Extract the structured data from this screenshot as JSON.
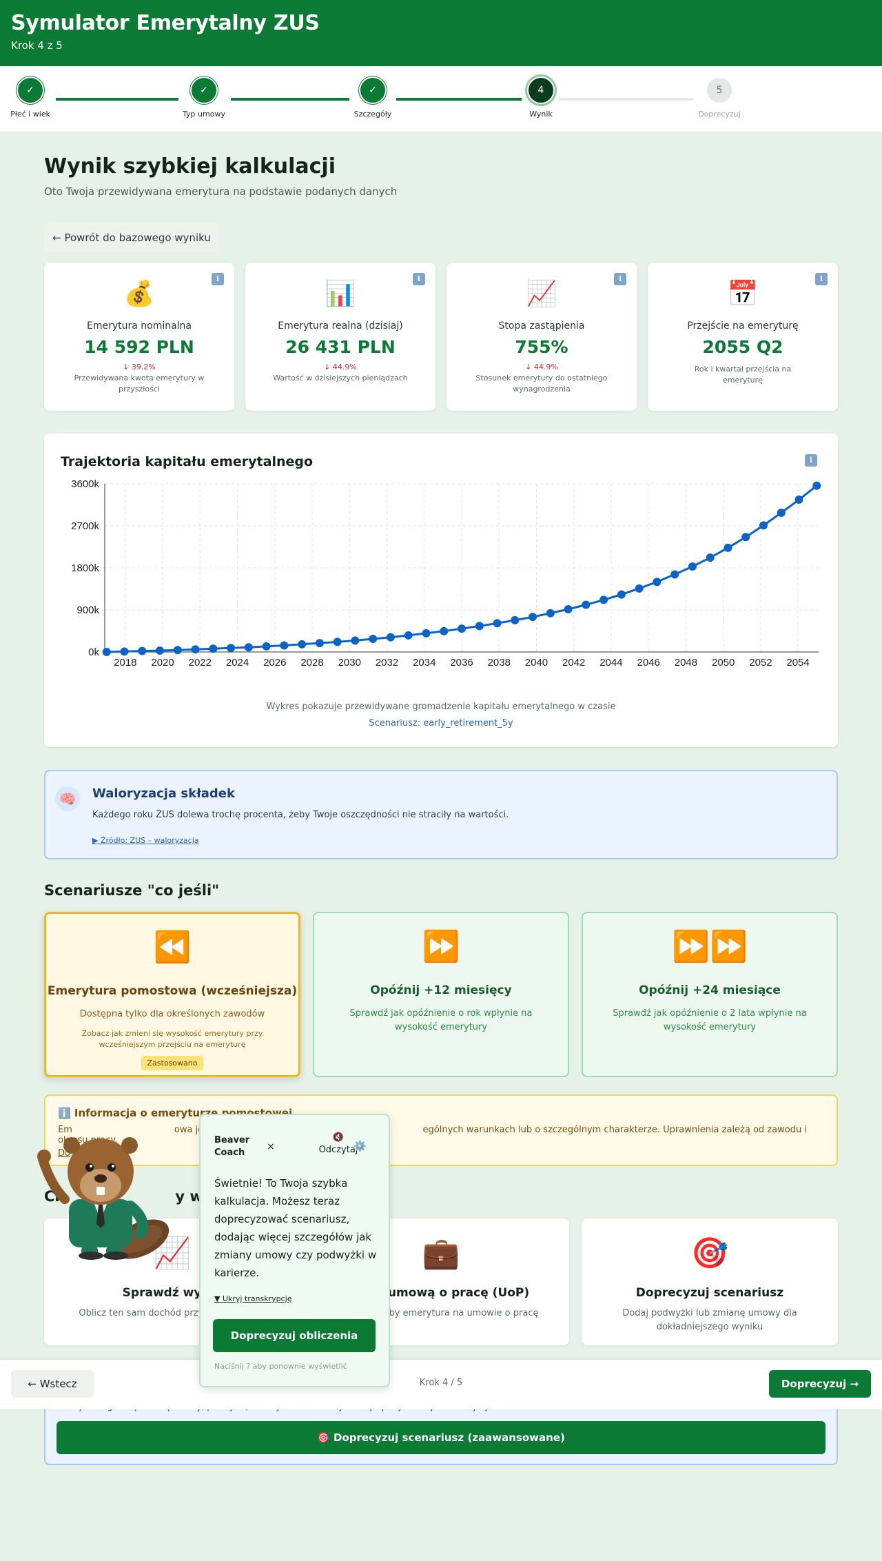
{
  "header": {
    "title": "Symulator Emerytalny ZUS",
    "subtitle": "Krok 4 z 5"
  },
  "stepper": [
    {
      "num": "✓",
      "label": "Płeć i wiek",
      "state": "done"
    },
    {
      "num": "✓",
      "label": "Typ umowy",
      "state": "done"
    },
    {
      "num": "✓",
      "label": "Szczegóły",
      "state": "done"
    },
    {
      "num": "4",
      "label": "Wynik",
      "state": "current"
    },
    {
      "num": "5",
      "label": "Doprecyzuj",
      "state": "todo"
    }
  ],
  "main": {
    "title": "Wynik szybkiej kalkulacji",
    "subtitle": "Oto Twoja przewidywana emerytura na podstawie podanych danych",
    "back_label": "← Powrót do bazowego wyniku"
  },
  "stats": [
    {
      "icon": "money-bag-icon",
      "emoji": "💰",
      "name": "Emerytura nominalna",
      "value": "14 592 PLN",
      "change": "↓ 39.2%",
      "desc": "Przewidywana kwota emerytury w przyszłości"
    },
    {
      "icon": "bar-chart-icon",
      "emoji": "📊",
      "name": "Emerytura realna (dzisiaj)",
      "value": "26 431 PLN",
      "change": "↓ 44.9%",
      "desc": "Wartość w dzisiejszych pieniądzach"
    },
    {
      "icon": "chart-increasing-icon",
      "emoji": "📈",
      "name": "Stopa zastąpienia",
      "value": "755%",
      "change": "↓ 44.9%",
      "desc": "Stosunek emerytury do ostatniego wynagrodzenia"
    },
    {
      "icon": "calendar-icon",
      "emoji": "📅",
      "name": "Przejście na emeryturę",
      "value": "2055 Q2",
      "change": "",
      "desc": "Rok i kwartał przejścia na emeryturę"
    }
  ],
  "info_icon": "ℹ",
  "chart_section": {
    "title": "Trajektoria kapitału emerytalnego",
    "caption": "Wykres pokazuje przewidywane gromadzenie kapitału emerytalnego w czasie",
    "scenario": "Scenariusz: early_retirement_5y"
  },
  "chart_data": {
    "type": "line",
    "x": [
      2017,
      2018,
      2019,
      2020,
      2021,
      2022,
      2023,
      2024,
      2025,
      2026,
      2027,
      2028,
      2029,
      2030,
      2031,
      2032,
      2033,
      2034,
      2035,
      2036,
      2037,
      2038,
      2039,
      2040,
      2041,
      2042,
      2043,
      2044,
      2045,
      2046,
      2047,
      2048,
      2049,
      2050,
      2051,
      2052,
      2053,
      2054,
      2055
    ],
    "values": [
      0,
      10,
      20,
      30,
      40,
      55,
      70,
      85,
      100,
      120,
      140,
      165,
      190,
      215,
      245,
      280,
      315,
      355,
      400,
      445,
      500,
      555,
      615,
      680,
      750,
      830,
      915,
      1010,
      1115,
      1230,
      1360,
      1500,
      1660,
      1830,
      2020,
      2230,
      2460,
      2710,
      2980,
      3260,
      3560
    ],
    "xticks": [
      "2018",
      "2020",
      "2022",
      "2024",
      "2026",
      "2028",
      "2030",
      "2032",
      "2034",
      "2036",
      "2038",
      "2040",
      "2042",
      "2044",
      "2046",
      "2048",
      "2050",
      "2052",
      "2054"
    ],
    "yticks": [
      "0k",
      "900k",
      "1800k",
      "2700k",
      "3600k"
    ],
    "ylim": [
      0,
      3600
    ],
    "grid": true,
    "color": "#0b63c7"
  },
  "walor": {
    "title": "Waloryzacja składek",
    "text": "Każdego roku ZUS dolewa trochę procenta, żeby Twoje oszczędności nie straciły na wartości.",
    "link": "▶ Źródło: ZUS – waloryzacja"
  },
  "scenarios": {
    "title": "Scenariusze \"co jeśli\"",
    "items": [
      {
        "emoji": "⏪",
        "title": "Emerytura pomostowa (wcześniejsza)",
        "desc": "Dostępna tylko dla określonych zawodów",
        "small": "Zobacz jak zmieni się wysokość emerytury przy wcześniejszym przejściu na emeryturę",
        "badge": "Zastosowano"
      },
      {
        "emoji": "⏩",
        "title": "Opóźnij +12 miesięcy",
        "desc": "Sprawdź jak opóźnienie o rok wpłynie na wysokość emerytury"
      },
      {
        "emoji": "⏩⏩",
        "title": "Opóźnij +24 miesiące",
        "desc": "Sprawdź jak opóźnienie o 2 lata wpłynie na wysokość emerytury"
      }
    ]
  },
  "warn": {
    "title": "ℹ️ Informacja o emeryturze pomostowej",
    "text_a": "Em",
    "text_b": "owa jest dostęp",
    "text_c": "ególnych warunkach lub o szczególnym charakterze. Uprawnienia zależą od zawodu i okresu pracy.",
    "link": "Do"
  },
  "options": {
    "title_a": "Ch",
    "title_b": "y wyn",
    "items": [
      {
        "emoji": "📈",
        "title": "Sprawdź wyższ",
        "desc": "Oblicz ten sam dochód przy w składkowej"
      },
      {
        "emoji": "💼",
        "title": "naj z umową o pracę (UoP)",
        "desc": "wyglądałaby emerytura na umowie o pracę"
      },
      {
        "emoji": "🎯",
        "title": "Doprecyzuj scenariusz",
        "desc": "Dodaj podwyżki lub zmianę umowy dla dokładniejszego wyniku"
      }
    ]
  },
  "advanced": {
    "text": "Dodaj szczegółową historię kariery, podwyżki, zmiany umów i okresy niskiej wpłaty dla najdokładniejszych obliczeń.",
    "button": "🎯 Doprecyzuj scenariusz (zaawansowane)"
  },
  "footer": {
    "prev": "← Wstecz",
    "step": "Krok 4 / 5",
    "next": "Doprecyzuj →"
  },
  "coach": {
    "name_line1": "Beaver",
    "name_line2": "Coach",
    "close": "×",
    "mute_icon": "🔇",
    "mute_label": "Odczytaj",
    "settings_icon": "⚙️",
    "message": "Świetnie! To Twoja szybka kalkulacja. Możesz teraz doprecyzować scenariusz, dodając więcej szczegółów jak zmiany umowy czy podwyżki w karierze.",
    "hide_link": "▼ Ukryj transkrypcję",
    "button": "Doprecyzuj obliczenia",
    "hint": "Naciśnij  ?  aby ponownie wyświetlić"
  }
}
